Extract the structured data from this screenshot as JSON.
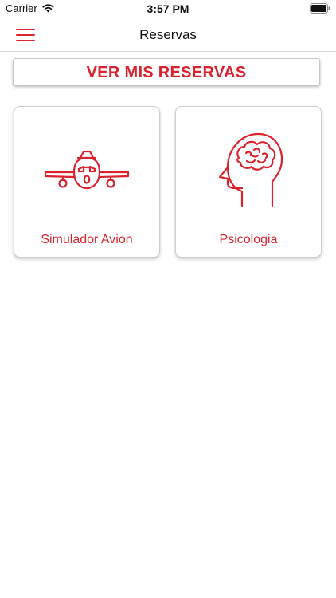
{
  "status_bar": {
    "carrier": "Carrier",
    "time": "3:57 PM"
  },
  "nav": {
    "title": "Reservas"
  },
  "reservas_button": {
    "label": "VER MIS RESERVAS"
  },
  "services": [
    {
      "label": "Simulador Avion",
      "icon": "airplane-icon"
    },
    {
      "label": "Psicologia",
      "icon": "brain-head-icon"
    }
  ],
  "colors": {
    "accent": "#d9242f",
    "menu": "#e0252f"
  }
}
